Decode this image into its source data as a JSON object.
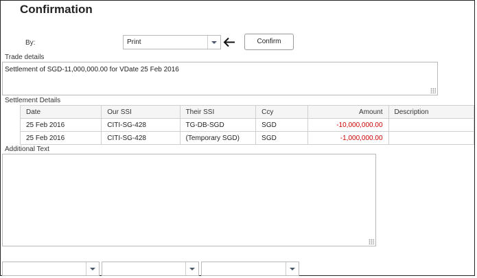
{
  "page": {
    "title": "Confirmation"
  },
  "by": {
    "label": "By:",
    "selected": "Print",
    "confirm_label": "Confirm"
  },
  "trade": {
    "label": "Trade details",
    "text": "Settlement of SGD-11,000,000.00 for VDate 25 Feb 2016"
  },
  "settlement": {
    "label": "Settlement Details",
    "headers": {
      "date": "Date",
      "our_ssi": "Our SSI",
      "their_ssi": "Their SSI",
      "ccy": "Ccy",
      "amount": "Amount",
      "description": "Description"
    },
    "rows": [
      {
        "date": "25 Feb 2016",
        "our_ssi": "CITI-SG-428",
        "their_ssi": "TG-DB-SGD",
        "ccy": "SGD",
        "amount": "-10,000,000.00",
        "description": ""
      },
      {
        "date": "25 Feb 2016",
        "our_ssi": "CITI-SG-428",
        "their_ssi": "(Temporary SGD)",
        "ccy": "SGD",
        "amount": "-1,000,000.00",
        "description": ""
      }
    ]
  },
  "additional": {
    "label": "Additional Text",
    "text": ""
  },
  "footer": {
    "selects": [
      "",
      "",
      ""
    ]
  },
  "colors": {
    "negative": "#cc0000",
    "border": "#b8b8b8",
    "header_bg": "#f5f5f5"
  },
  "icons": {
    "back": "left-arrow-icon",
    "dropdown": "chevron-down-icon",
    "resize": "resize-grip-icon"
  }
}
